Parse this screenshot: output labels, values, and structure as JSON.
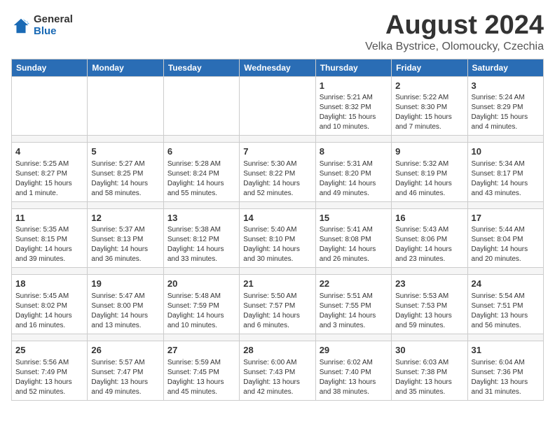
{
  "logo": {
    "general": "General",
    "blue": "Blue"
  },
  "title": "August 2024",
  "subtitle": "Velka Bystrice, Olomoucky, Czechia",
  "days_of_week": [
    "Sunday",
    "Monday",
    "Tuesday",
    "Wednesday",
    "Thursday",
    "Friday",
    "Saturday"
  ],
  "weeks": [
    [
      {
        "day": "",
        "info": ""
      },
      {
        "day": "",
        "info": ""
      },
      {
        "day": "",
        "info": ""
      },
      {
        "day": "",
        "info": ""
      },
      {
        "day": "1",
        "info": "Sunrise: 5:21 AM\nSunset: 8:32 PM\nDaylight: 15 hours\nand 10 minutes."
      },
      {
        "day": "2",
        "info": "Sunrise: 5:22 AM\nSunset: 8:30 PM\nDaylight: 15 hours\nand 7 minutes."
      },
      {
        "day": "3",
        "info": "Sunrise: 5:24 AM\nSunset: 8:29 PM\nDaylight: 15 hours\nand 4 minutes."
      }
    ],
    [
      {
        "day": "4",
        "info": "Sunrise: 5:25 AM\nSunset: 8:27 PM\nDaylight: 15 hours\nand 1 minute."
      },
      {
        "day": "5",
        "info": "Sunrise: 5:27 AM\nSunset: 8:25 PM\nDaylight: 14 hours\nand 58 minutes."
      },
      {
        "day": "6",
        "info": "Sunrise: 5:28 AM\nSunset: 8:24 PM\nDaylight: 14 hours\nand 55 minutes."
      },
      {
        "day": "7",
        "info": "Sunrise: 5:30 AM\nSunset: 8:22 PM\nDaylight: 14 hours\nand 52 minutes."
      },
      {
        "day": "8",
        "info": "Sunrise: 5:31 AM\nSunset: 8:20 PM\nDaylight: 14 hours\nand 49 minutes."
      },
      {
        "day": "9",
        "info": "Sunrise: 5:32 AM\nSunset: 8:19 PM\nDaylight: 14 hours\nand 46 minutes."
      },
      {
        "day": "10",
        "info": "Sunrise: 5:34 AM\nSunset: 8:17 PM\nDaylight: 14 hours\nand 43 minutes."
      }
    ],
    [
      {
        "day": "11",
        "info": "Sunrise: 5:35 AM\nSunset: 8:15 PM\nDaylight: 14 hours\nand 39 minutes."
      },
      {
        "day": "12",
        "info": "Sunrise: 5:37 AM\nSunset: 8:13 PM\nDaylight: 14 hours\nand 36 minutes."
      },
      {
        "day": "13",
        "info": "Sunrise: 5:38 AM\nSunset: 8:12 PM\nDaylight: 14 hours\nand 33 minutes."
      },
      {
        "day": "14",
        "info": "Sunrise: 5:40 AM\nSunset: 8:10 PM\nDaylight: 14 hours\nand 30 minutes."
      },
      {
        "day": "15",
        "info": "Sunrise: 5:41 AM\nSunset: 8:08 PM\nDaylight: 14 hours\nand 26 minutes."
      },
      {
        "day": "16",
        "info": "Sunrise: 5:43 AM\nSunset: 8:06 PM\nDaylight: 14 hours\nand 23 minutes."
      },
      {
        "day": "17",
        "info": "Sunrise: 5:44 AM\nSunset: 8:04 PM\nDaylight: 14 hours\nand 20 minutes."
      }
    ],
    [
      {
        "day": "18",
        "info": "Sunrise: 5:45 AM\nSunset: 8:02 PM\nDaylight: 14 hours\nand 16 minutes."
      },
      {
        "day": "19",
        "info": "Sunrise: 5:47 AM\nSunset: 8:00 PM\nDaylight: 14 hours\nand 13 minutes."
      },
      {
        "day": "20",
        "info": "Sunrise: 5:48 AM\nSunset: 7:59 PM\nDaylight: 14 hours\nand 10 minutes."
      },
      {
        "day": "21",
        "info": "Sunrise: 5:50 AM\nSunset: 7:57 PM\nDaylight: 14 hours\nand 6 minutes."
      },
      {
        "day": "22",
        "info": "Sunrise: 5:51 AM\nSunset: 7:55 PM\nDaylight: 14 hours\nand 3 minutes."
      },
      {
        "day": "23",
        "info": "Sunrise: 5:53 AM\nSunset: 7:53 PM\nDaylight: 13 hours\nand 59 minutes."
      },
      {
        "day": "24",
        "info": "Sunrise: 5:54 AM\nSunset: 7:51 PM\nDaylight: 13 hours\nand 56 minutes."
      }
    ],
    [
      {
        "day": "25",
        "info": "Sunrise: 5:56 AM\nSunset: 7:49 PM\nDaylight: 13 hours\nand 52 minutes."
      },
      {
        "day": "26",
        "info": "Sunrise: 5:57 AM\nSunset: 7:47 PM\nDaylight: 13 hours\nand 49 minutes."
      },
      {
        "day": "27",
        "info": "Sunrise: 5:59 AM\nSunset: 7:45 PM\nDaylight: 13 hours\nand 45 minutes."
      },
      {
        "day": "28",
        "info": "Sunrise: 6:00 AM\nSunset: 7:43 PM\nDaylight: 13 hours\nand 42 minutes."
      },
      {
        "day": "29",
        "info": "Sunrise: 6:02 AM\nSunset: 7:40 PM\nDaylight: 13 hours\nand 38 minutes."
      },
      {
        "day": "30",
        "info": "Sunrise: 6:03 AM\nSunset: 7:38 PM\nDaylight: 13 hours\nand 35 minutes."
      },
      {
        "day": "31",
        "info": "Sunrise: 6:04 AM\nSunset: 7:36 PM\nDaylight: 13 hours\nand 31 minutes."
      }
    ]
  ]
}
